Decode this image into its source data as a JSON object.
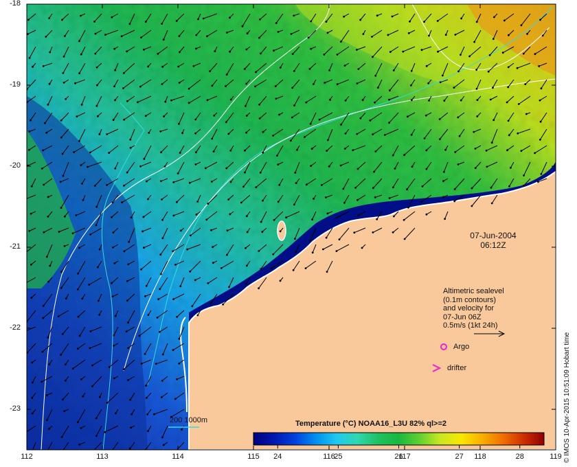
{
  "map": {
    "date": "07-Jun-2004",
    "time": "06:12Z",
    "lat_ticks": [
      "-18",
      "-19",
      "-20",
      "-21",
      "-22",
      "-23"
    ],
    "lon_ticks": [
      "112",
      "113",
      "114",
      "115",
      "116",
      "117",
      "118",
      "119"
    ],
    "lon_range": [
      112,
      119
    ],
    "lat_range": [
      -23.5,
      -18
    ],
    "land_color": "#f9c99c",
    "coastline_color": "#ffffff"
  },
  "legend": {
    "line1": "Altimetric sealevel",
    "line2": "(0.1m contours)",
    "line3": "and velocity for",
    "line4": "07-Jun 06Z",
    "line5": "0.5m/s (1kt 24h)",
    "argo_label": "Argo",
    "drifter_label": "drifter",
    "argo_color": "#ee22cc",
    "drifter_color": "#ee22cc"
  },
  "contours": {
    "label": "200  1000m",
    "color": "#33dddd"
  },
  "colorbar": {
    "title": "Temperature (°C) NOAA16_L3U 82% ql>=2",
    "ticks": [
      "24",
      "25",
      "26",
      "27",
      "28"
    ],
    "range": [
      23.6,
      28.4
    ],
    "colors": [
      "#00007a",
      "#0018b0",
      "#0040e0",
      "#0090ee",
      "#20c8f0",
      "#30d8b0",
      "#20c060",
      "#18b840",
      "#60d030",
      "#c8e820",
      "#f8e800",
      "#f8b000",
      "#f07000",
      "#d03000",
      "#900000"
    ]
  },
  "credit": "© IMOS 10-Apr-2015 10:51:09 Hobart time"
}
